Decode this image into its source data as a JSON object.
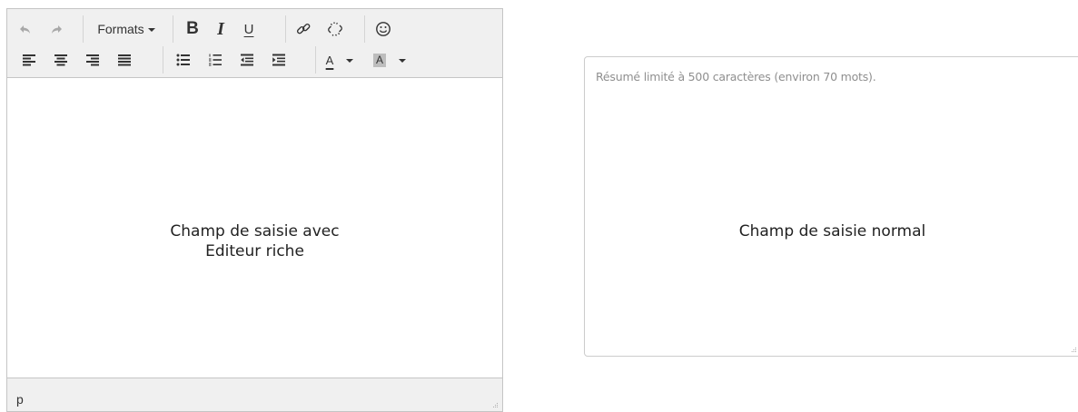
{
  "rich_editor": {
    "toolbar": {
      "formats_label": "Formats",
      "bold_label": "B",
      "italic_label": "I",
      "underline_label": "U",
      "font_color_label": "A",
      "bg_color_label": "A",
      "icons": [
        "undo-icon",
        "redo-icon",
        "link-icon",
        "unlink-icon",
        "emoticon-icon",
        "align-left-icon",
        "align-center-icon",
        "align-right-icon",
        "align-justify-icon",
        "bullet-list-icon",
        "numbered-list-icon",
        "outdent-icon",
        "indent-icon"
      ]
    },
    "content_line1": "Champ de saisie avec",
    "content_line2": "Editeur riche",
    "status_path": "p"
  },
  "plain_field": {
    "placeholder": "Résumé limité à 500 caractères (environ 70 mots).",
    "content": "Champ de saisie normal"
  }
}
